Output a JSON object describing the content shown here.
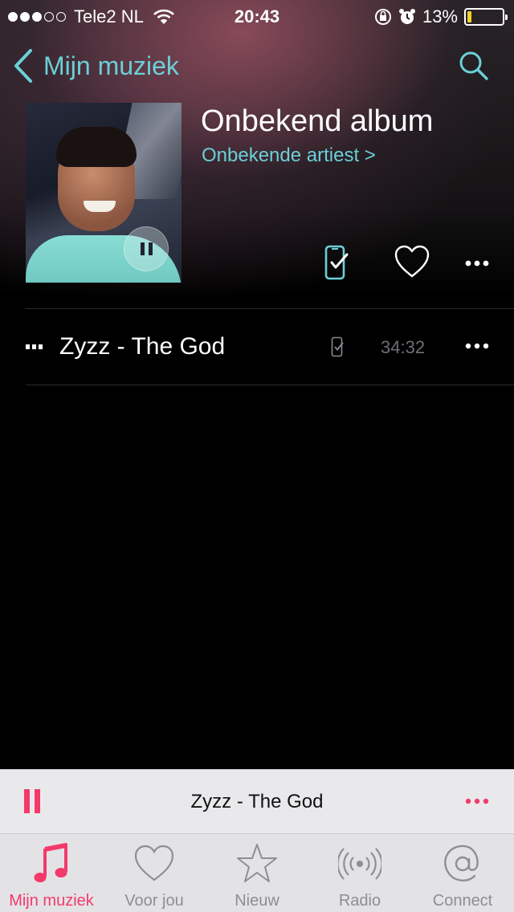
{
  "status_bar": {
    "carrier": "Tele2 NL",
    "time": "20:43",
    "battery_percent_label": "13%",
    "battery_level": 0.13,
    "signal_bars_filled": 3,
    "signal_bars_total": 5
  },
  "nav": {
    "back_label": "Mijn muziek",
    "search_icon": "search-icon"
  },
  "album": {
    "title": "Onbekend album",
    "artist": "Onbekende artiest >"
  },
  "tracks": [
    {
      "title": "Zyzz - The God",
      "duration": "34:32",
      "playing": true
    }
  ],
  "mini_player": {
    "title": "Zyzz - The God",
    "state": "playing"
  },
  "tab_bar": {
    "active": "mijn-muziek",
    "tabs": [
      {
        "label": "Mijn muziek",
        "icon": "music-note-icon"
      },
      {
        "label": "Voor jou",
        "icon": "heart-icon"
      },
      {
        "label": "Nieuw",
        "icon": "star-icon"
      },
      {
        "label": "Radio",
        "icon": "radio-icon"
      },
      {
        "label": "Connect",
        "icon": "at-sign-icon"
      }
    ]
  },
  "colors": {
    "accent_teal": "#6ad0d8",
    "accent_pink": "#f33a6a",
    "battery_fill": "#f2d22a"
  }
}
